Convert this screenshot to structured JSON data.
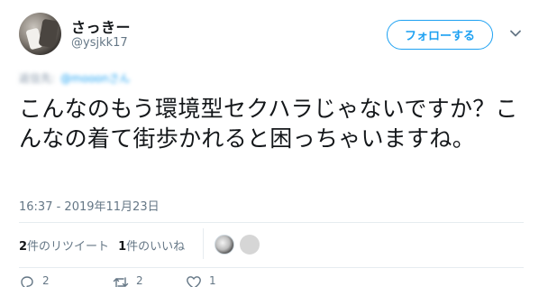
{
  "user": {
    "display_name": "さっきー",
    "handle": "@ysjkk17"
  },
  "follow_button_label": "フォローする",
  "reply_context": {
    "prefix": "返信先:",
    "mention": "@mooonさん"
  },
  "tweet": {
    "text": "こんなのもう環境型セクハラじゃないですか？こんなの着て街歩かれると困っちゃいますね。",
    "timestamp": "16:37 - 2019年11月23日"
  },
  "stats": {
    "retweet_count": "2",
    "retweet_label": "件のリツイート",
    "like_count": "1",
    "like_label": "件のいいね"
  },
  "actions": {
    "reply_count": "2",
    "retweet_count": "2",
    "like_count": "1"
  },
  "colors": {
    "accent": "#1da1f2",
    "text": "#14171a",
    "muted": "#657786",
    "divider": "#e6ecf0"
  },
  "icons": [
    "chevron-down-icon",
    "reply-icon",
    "retweet-icon",
    "like-icon"
  ]
}
